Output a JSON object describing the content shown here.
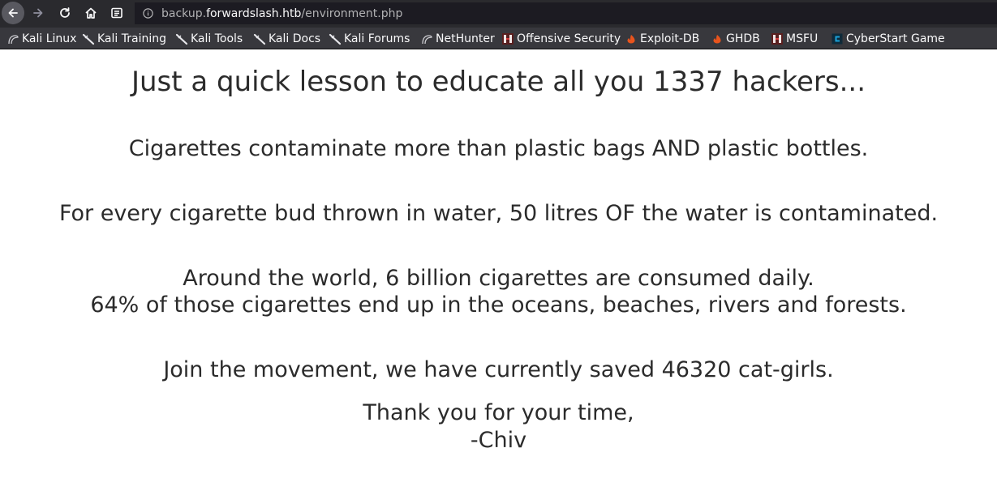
{
  "browser": {
    "url": {
      "subdomain": "backup.",
      "host": "forwardslash.htb",
      "path": "/environment.php"
    },
    "nav": {
      "back_icon": "back-arrow-icon",
      "forward_icon": "forward-arrow-icon",
      "reload_icon": "reload-icon",
      "home_icon": "home-icon",
      "reader_icon": "reader-view-icon",
      "info_icon": "info-icon"
    },
    "bookmarks": [
      {
        "label": "Kali Linux",
        "icon": "kali-dragon-icon"
      },
      {
        "label": "Kali Training",
        "icon": "kali-sword-icon"
      },
      {
        "label": "Kali Tools",
        "icon": "kali-sword-icon"
      },
      {
        "label": "Kali Docs",
        "icon": "kali-sword-icon"
      },
      {
        "label": "Kali Forums",
        "icon": "kali-sword-icon"
      },
      {
        "label": "NetHunter",
        "icon": "kali-dragon-icon"
      },
      {
        "label": "Offensive Security",
        "icon": "offsec-icon"
      },
      {
        "label": "Exploit-DB",
        "icon": "exploit-db-icon"
      },
      {
        "label": "GHDB",
        "icon": "exploit-db-icon"
      },
      {
        "label": "MSFU",
        "icon": "offsec-icon"
      },
      {
        "label": "CyberStart Game",
        "icon": "cyberstart-icon"
      }
    ],
    "colors": {
      "toolbar": "#2a2a2e",
      "urlbar": "#1c1b22",
      "bookmarks_bar": "#38383d",
      "exploitdb_accent": "#e8541d",
      "cyberstart_accent": "#1ba1d9"
    }
  },
  "page": {
    "heading": "Just a quick lesson to educate all you 1337 hackers...",
    "line1": "Cigarettes contaminate more than plastic bags AND plastic bottles.",
    "line2": "For every cigarette bud thrown in water, 50 litres OF the water is contaminated.",
    "line3a": "Around the world, 6 billion cigarettes are consumed daily.",
    "line3b": "64% of those cigarettes end up in the oceans, beaches, rivers and forests.",
    "line4": "Join the movement, we have currently saved 46320 cat-girls.",
    "signoff1": "Thank you for your time,",
    "signoff2": "-Chiv"
  }
}
